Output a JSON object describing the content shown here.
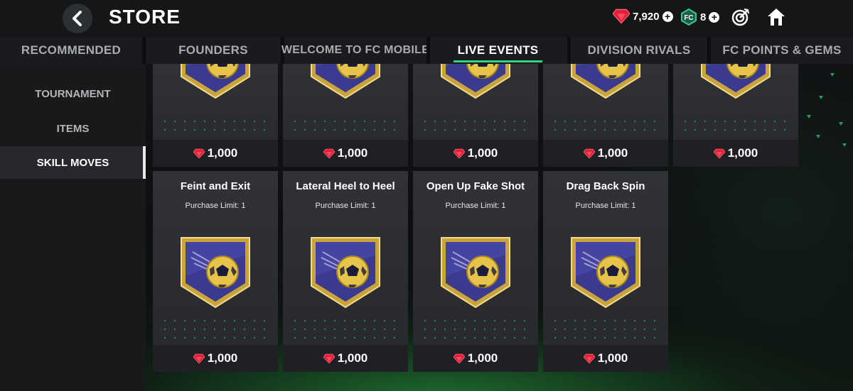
{
  "header": {
    "title": "STORE",
    "gems": "7,920",
    "fc_points": "8",
    "colors": {
      "gem": "#e0203a",
      "fc_points": "#34c98a",
      "accent": "#33d17a"
    }
  },
  "tabs": [
    {
      "label": "RECOMMENDED"
    },
    {
      "label": "FOUNDERS"
    },
    {
      "label": "WELCOME TO FC MOBILE"
    },
    {
      "label": "LIVE EVENTS"
    },
    {
      "label": "DIVISION RIVALS"
    },
    {
      "label": "FC POINTS & GEMS"
    }
  ],
  "active_tab": "LIVE EVENTS",
  "sidebar": {
    "items": [
      {
        "label": "TOURNAMENT"
      },
      {
        "label": "ITEMS"
      },
      {
        "label": "SKILL MOVES"
      }
    ],
    "active": "SKILL MOVES"
  },
  "top_row": [
    {
      "price": "1,000"
    },
    {
      "price": "1,000"
    },
    {
      "price": "1,000"
    },
    {
      "price": "1,000"
    },
    {
      "price": "1,000"
    }
  ],
  "cards": [
    {
      "name": "Feint and Exit",
      "limit": "Purchase Limit: 1",
      "price": "1,000"
    },
    {
      "name": "Lateral Heel to Heel",
      "limit": "Purchase Limit: 1",
      "price": "1,000"
    },
    {
      "name": "Open Up Fake Shot",
      "limit": "Purchase Limit: 1",
      "price": "1,000"
    },
    {
      "name": "Drag Back Spin",
      "limit": "Purchase Limit: 1",
      "price": "1,000"
    }
  ]
}
